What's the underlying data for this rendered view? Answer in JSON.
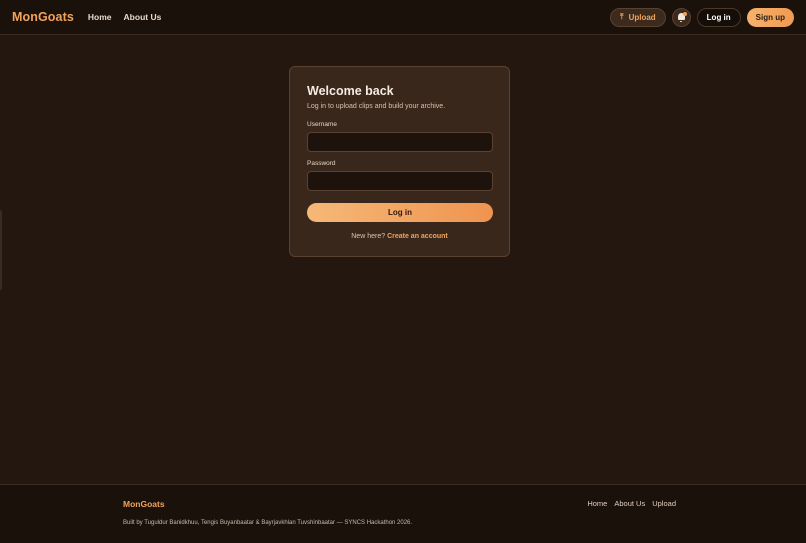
{
  "header": {
    "brand": "MonGoats",
    "nav": [
      {
        "label": "Home"
      },
      {
        "label": "About Us"
      }
    ],
    "upload_label": "Upload",
    "upload_glyph": "⤒",
    "login_label": "Log in",
    "signup_label": "Sign up"
  },
  "login_card": {
    "title": "Welcome back",
    "subtitle": "Log in to upload clips and build your archive.",
    "username_label": "Username",
    "username_value": "",
    "password_label": "Password",
    "password_value": "",
    "submit_label": "Log in",
    "footer_prompt": "New here?",
    "footer_link": "Create an account"
  },
  "footer": {
    "brand": "MonGoats",
    "links": [
      {
        "label": "Home"
      },
      {
        "label": "About Us"
      },
      {
        "label": "Upload"
      }
    ],
    "credits": "Built by Tuguldur Banidkhuu, Tengis Buyanbaatar & Bayrjavkhlan Tuvshinbaatar — SYNCS Hackathon 2026."
  },
  "colors": {
    "accent": "#f2a35c",
    "background": "#24170f",
    "card": "#3a271b"
  },
  "icons": {
    "upload": "upload-icon",
    "notifications": "bell-icon"
  }
}
